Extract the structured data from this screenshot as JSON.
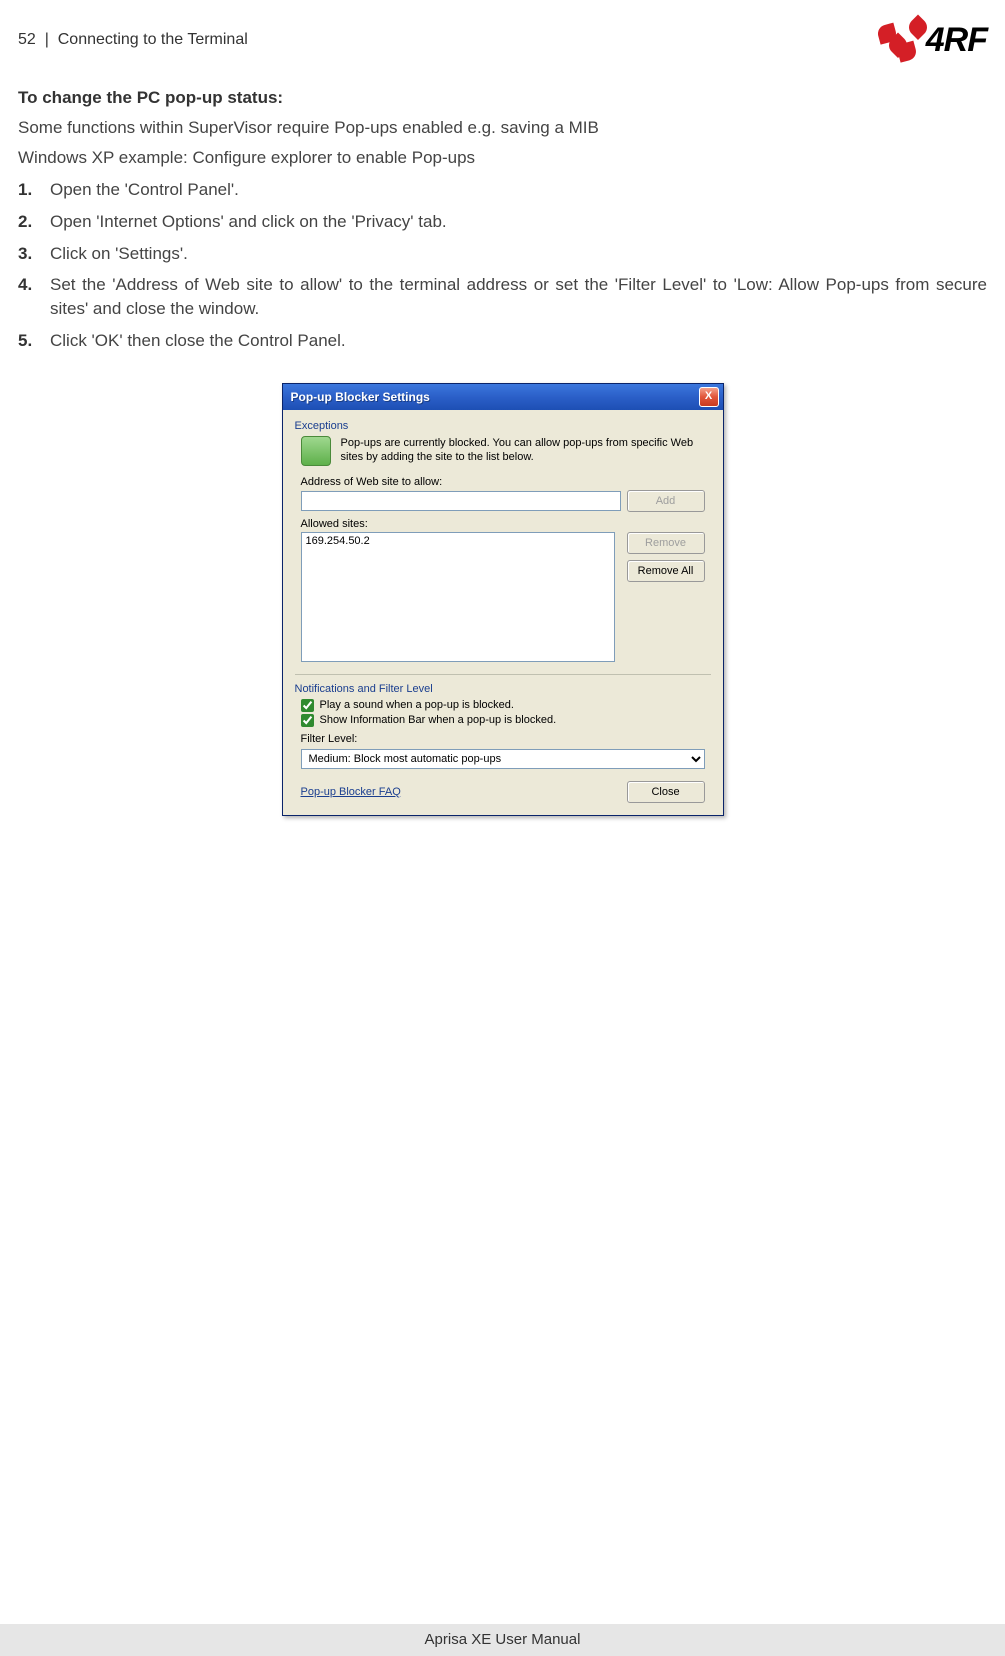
{
  "header": {
    "page_number": "52",
    "separator": "|",
    "section": "Connecting to the Terminal",
    "logo_text": "4RF"
  },
  "content": {
    "title": "To change the PC pop-up status:",
    "intro1": "Some functions within SuperVisor require Pop-ups enabled e.g. saving a MIB",
    "intro2": "Windows XP example: Configure explorer to enable Pop-ups",
    "steps": [
      "Open the 'Control Panel'.",
      "Open 'Internet Options' and click on the 'Privacy' tab.",
      "Click on 'Settings'.",
      "Set the 'Address of Web site to allow' to the terminal address or set the 'Filter Level' to 'Low: Allow Pop-ups from secure sites' and close the window.",
      "Click 'OK' then close the Control Panel."
    ]
  },
  "dialog": {
    "title": "Pop-up Blocker Settings",
    "close_glyph": "X",
    "exceptions_label": "Exceptions",
    "description": "Pop-ups are currently blocked. You can allow pop-ups from specific Web sites by adding the site to the list below.",
    "address_label": "Address of Web site to allow:",
    "address_value": "",
    "add_btn": "Add",
    "allowed_label": "Allowed sites:",
    "allowed_item": "169.254.50.2",
    "remove_btn": "Remove",
    "remove_all_btn": "Remove All",
    "notif_label": "Notifications and Filter Level",
    "check1": "Play a sound when a pop-up is blocked.",
    "check2": "Show Information Bar when a pop-up is blocked.",
    "filter_label": "Filter Level:",
    "filter_value": "Medium: Block most automatic pop-ups",
    "faq_link": "Pop-up Blocker FAQ",
    "close_btn": "Close"
  },
  "footer": {
    "text": "Aprisa XE User Manual"
  }
}
